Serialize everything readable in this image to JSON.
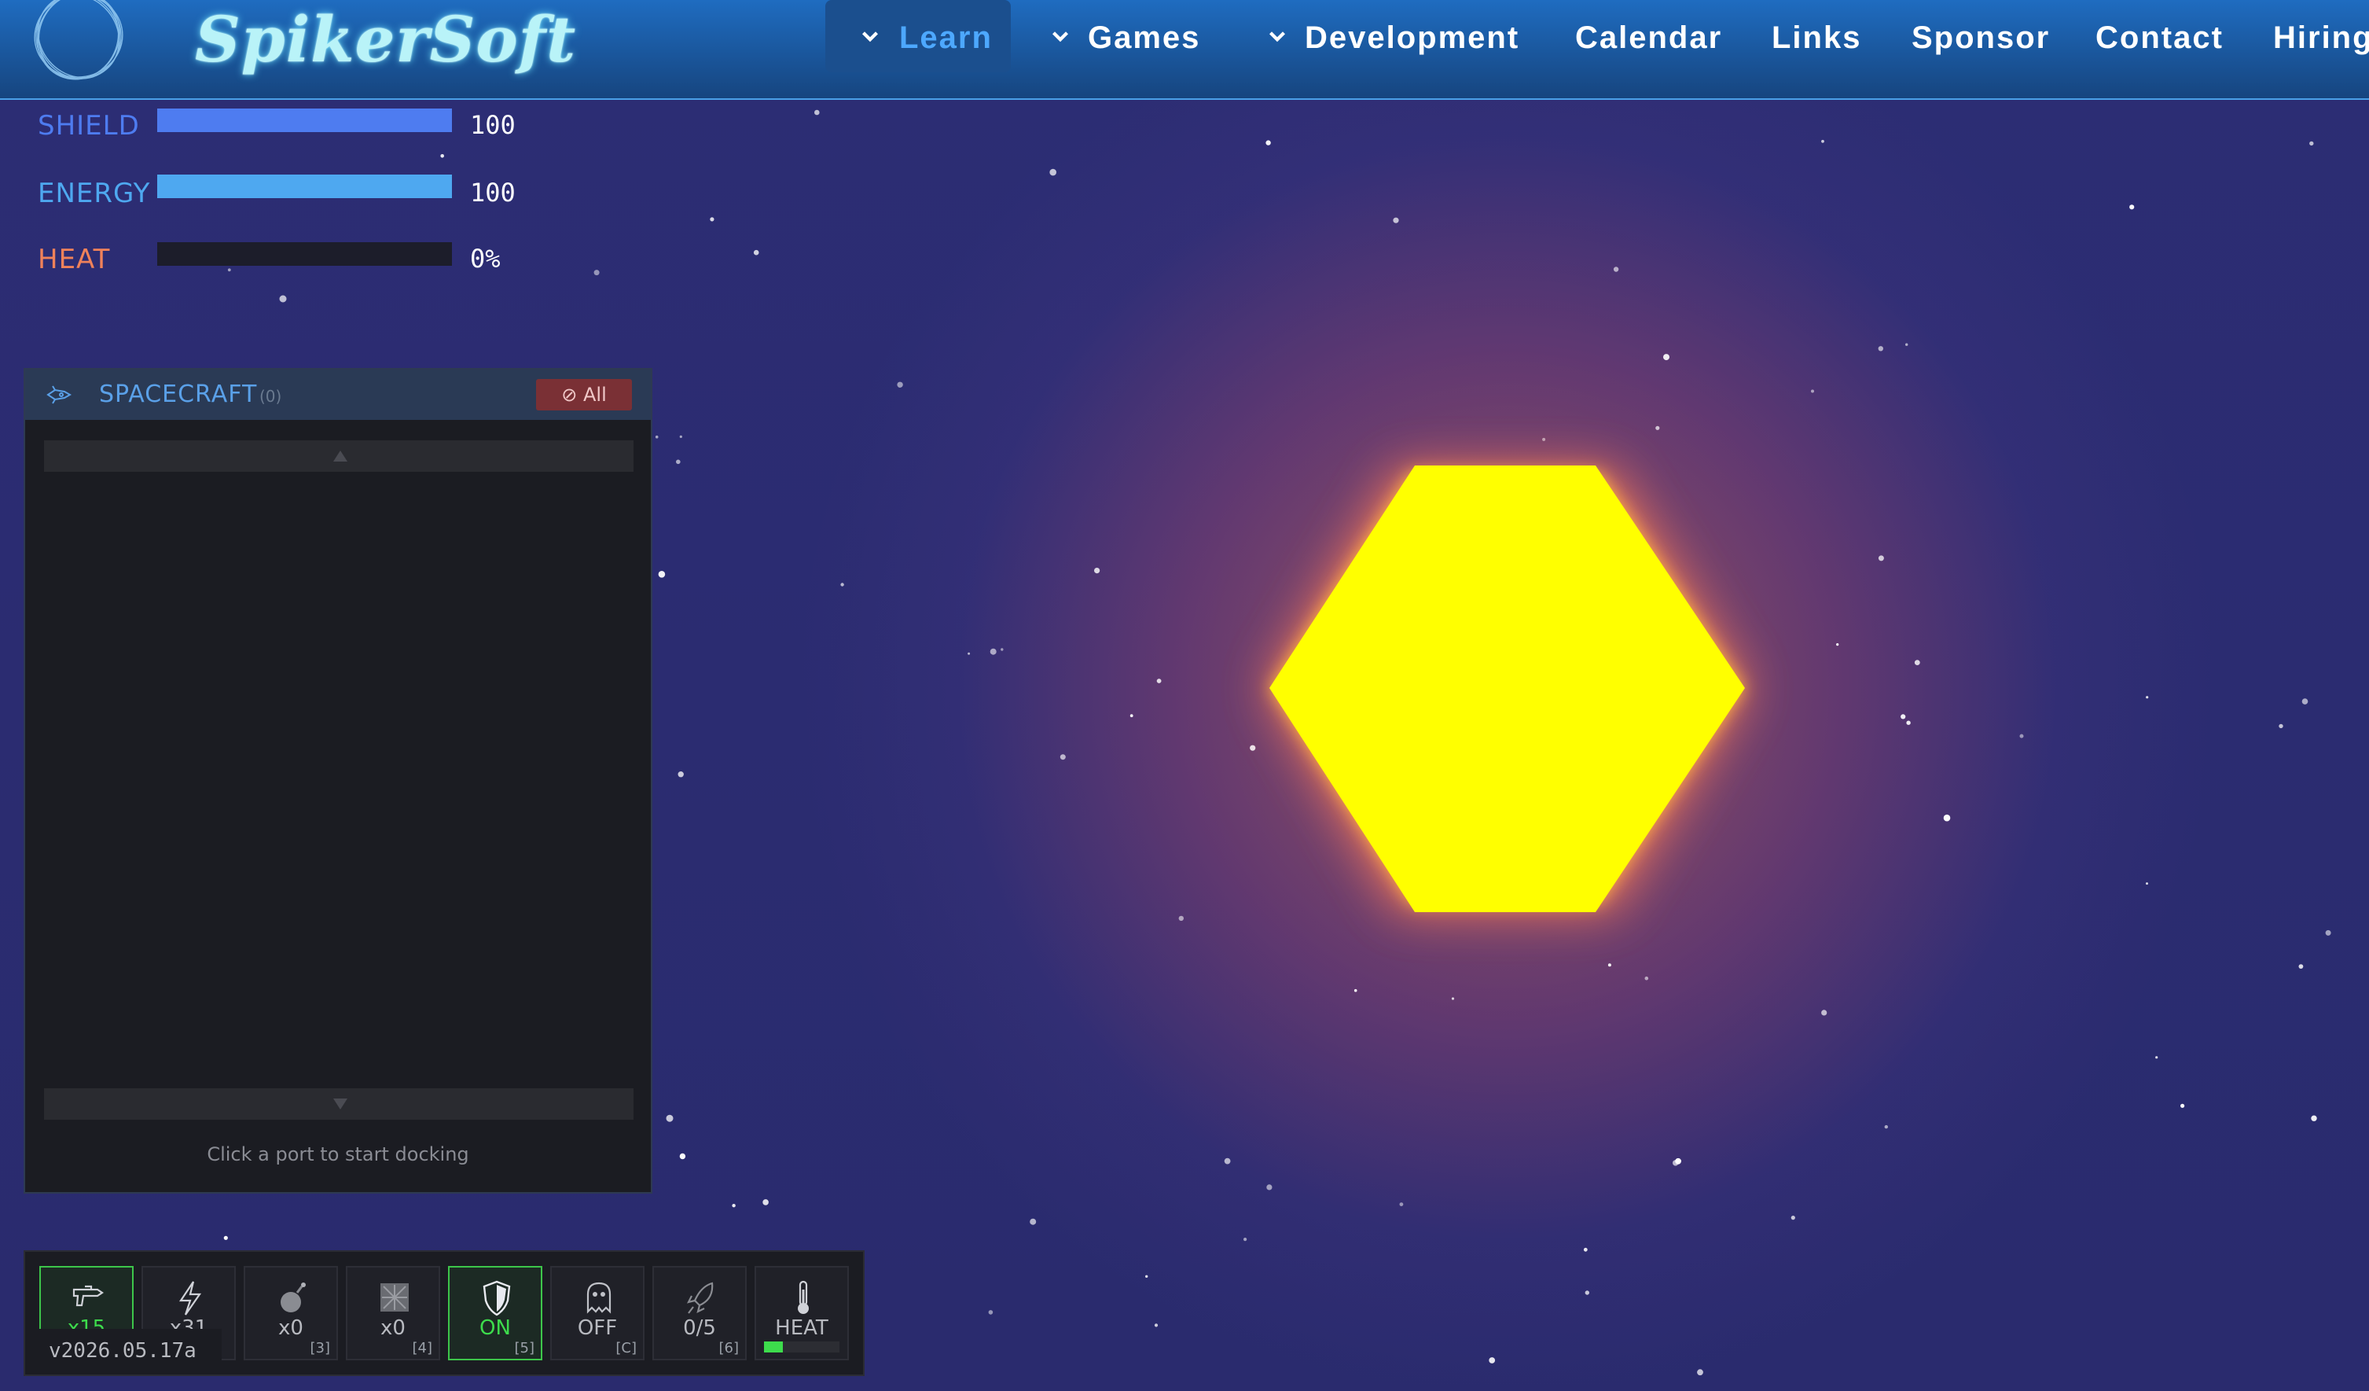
{
  "site": {
    "logo_text": "SpikerSoft",
    "nav": [
      {
        "label": "Learn",
        "has_chevron": true,
        "active": true
      },
      {
        "label": "Games",
        "has_chevron": true,
        "active": false
      },
      {
        "label": "Development",
        "has_chevron": true,
        "active": false
      },
      {
        "label": "Calendar",
        "has_chevron": false,
        "active": false
      },
      {
        "label": "Links",
        "has_chevron": false,
        "active": false
      },
      {
        "label": "Sponsor",
        "has_chevron": false,
        "active": false
      },
      {
        "label": "Contact",
        "has_chevron": false,
        "active": false
      },
      {
        "label": "Hiring",
        "has_chevron": false,
        "active": false
      }
    ]
  },
  "hud": {
    "shield": {
      "label": "SHIELD",
      "value": "100",
      "fill": 1.0,
      "color": "#4e7cf0"
    },
    "energy": {
      "label": "ENERGY",
      "value": "100",
      "fill": 1.0,
      "color": "#4ea8f0"
    },
    "heat": {
      "label": "HEAT",
      "value": "0%",
      "fill": 0.0,
      "color": "#f0825a"
    }
  },
  "panel": {
    "title": "SPACECRAFT",
    "count": "(0)",
    "filter_label": "⊘ All",
    "icon": "spacecraft-icon",
    "hint": "Click a port to start docking"
  },
  "toolbar": {
    "tools": [
      {
        "name": "blaster-tool",
        "icon": "blaster-icon",
        "label": "x15",
        "key": "",
        "active": true
      },
      {
        "name": "lightning-tool",
        "icon": "lightning-icon",
        "label": "x31",
        "key": "",
        "active": false
      },
      {
        "name": "bomb-tool",
        "icon": "bomb-icon",
        "label": "x0",
        "key": "[3]",
        "active": false
      },
      {
        "name": "mine-tool",
        "icon": "mine-icon",
        "label": "x0",
        "key": "[4]",
        "active": false
      },
      {
        "name": "shield-tool",
        "icon": "shield-icon",
        "label": "ON",
        "key": "[5]",
        "active": true
      },
      {
        "name": "cloak-tool",
        "icon": "ghost-icon",
        "label": "OFF",
        "key": "[C]",
        "active": false
      },
      {
        "name": "rocket-tool",
        "icon": "rocket-icon",
        "label": "0/5",
        "key": "[6]",
        "active": false
      },
      {
        "name": "heat-tool",
        "icon": "thermometer-icon",
        "label": "HEAT",
        "key": "",
        "active": false,
        "heat_fill": 0.25
      }
    ]
  },
  "version": "v2026.05.17a",
  "colors": {
    "nav_bg": "#1a5aa3",
    "space_bg": "#2a2b70",
    "sun_core": "#ffff00",
    "sun_glow": "#ff7a5a",
    "accent_active": "#3ddc4c"
  }
}
